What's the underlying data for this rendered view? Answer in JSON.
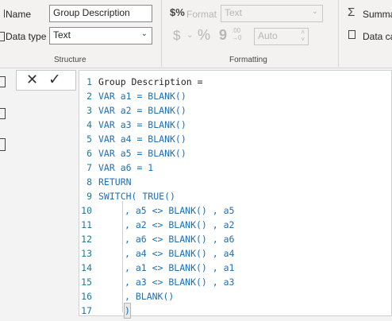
{
  "ribbon": {
    "structure": {
      "name_label": "Name",
      "name_value": "Group Description",
      "datatype_label": "Data type",
      "datatype_value": "Text",
      "group_title": "Structure"
    },
    "formatting": {
      "format_label": "Format",
      "format_value": "Text",
      "currency_symbol": "$",
      "percent_symbol": "%",
      "comma_symbol": "9",
      "decimals_value": "Auto",
      "group_title": "Formatting"
    },
    "properties": {
      "summarize_label": "Summa",
      "data_category_label": "Data ca"
    }
  },
  "formula_bar": {
    "cancel_glyph": "✕",
    "commit_glyph": "✓"
  },
  "editor": {
    "lines": [
      {
        "n": "1",
        "text": "Group Description ="
      },
      {
        "n": "2",
        "text": "VAR a1 = BLANK()"
      },
      {
        "n": "3",
        "text": "VAR a2 = BLANK()"
      },
      {
        "n": "4",
        "text": "VAR a3 = BLANK()"
      },
      {
        "n": "5",
        "text": "VAR a4 = BLANK()"
      },
      {
        "n": "6",
        "text": "VAR a5 = BLANK()"
      },
      {
        "n": "7",
        "text": "VAR a6 = 1"
      },
      {
        "n": "8",
        "text": "RETURN"
      },
      {
        "n": "9",
        "text": "SWITCH( TRUE()"
      },
      {
        "n": "10",
        "text": ", a5 <> BLANK() , a5"
      },
      {
        "n": "11",
        "text": ", a2 <> BLANK() , a2"
      },
      {
        "n": "12",
        "text": ", a6 <> BLANK() , a6"
      },
      {
        "n": "13",
        "text": ", a4 <> BLANK() , a4"
      },
      {
        "n": "14",
        "text": ", a1 <> BLANK() , a1"
      },
      {
        "n": "15",
        "text": ", a3 <> BLANK() , a3"
      },
      {
        "n": "16",
        "text": ", BLANK()"
      },
      {
        "n": "17",
        "text": ")"
      }
    ]
  }
}
